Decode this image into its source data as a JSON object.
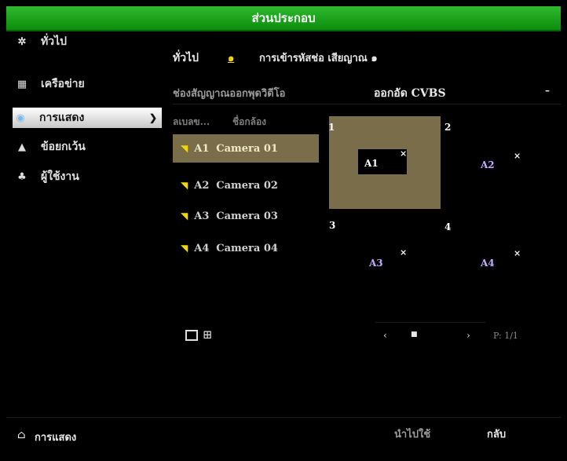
{
  "window": {
    "title": "ส่วนประกอบ"
  },
  "sidebar": {
    "items": [
      {
        "label": "ทั่วไป",
        "icon": "gear-icon"
      },
      {
        "label": "เครือข่าย",
        "icon": "network-icon"
      },
      {
        "label": "การแสดง",
        "icon": "eye-icon",
        "active": true
      },
      {
        "label": "ข้อยกเว้น",
        "icon": "warning-icon"
      },
      {
        "label": "ผู้ใช้งาน",
        "icon": "users-icon"
      }
    ]
  },
  "header": {
    "tab_general": "ทั่วไป",
    "tab_indicator": "๑",
    "tab_encoding": "การเข้ารหัสช่อ เสียญาณ ๑"
  },
  "video_output": {
    "label": "ช่องสัญญาณออกพุดวิดีโอ",
    "value": "ออกอัด CVBS"
  },
  "camera_list": {
    "col_number": "ลเบลข...",
    "col_name": "ชื่อกล้อง",
    "rows": [
      {
        "id": "A1",
        "name": "Camera 01",
        "selected": true
      },
      {
        "id": "A2",
        "name": "Camera 02"
      },
      {
        "id": "A3",
        "name": "Camera 03"
      },
      {
        "id": "A4",
        "name": "Camera 04"
      }
    ]
  },
  "preview": {
    "cells": [
      {
        "slot": "1",
        "camera": "A1",
        "remove": "×",
        "active": true
      },
      {
        "slot": "2",
        "camera": "A2",
        "remove": "×"
      },
      {
        "slot": "3",
        "camera": "A3",
        "remove": "×"
      },
      {
        "slot": "4",
        "camera": "A4",
        "remove": "×"
      }
    ],
    "pager": {
      "prev": "‹",
      "stop": "■",
      "next": "›",
      "page": "P: 1/1"
    }
  },
  "footer": {
    "location": "การแสดง",
    "apply_label": "นำไปใช้",
    "back_label": "กลับ"
  },
  "colors": {
    "title_bar": "#1aa51a",
    "camera_icon": "#f1d700",
    "slot_a1": "#ffffff",
    "slot_other": "#c9a7ff",
    "selected_row": "#7a6e4a"
  }
}
